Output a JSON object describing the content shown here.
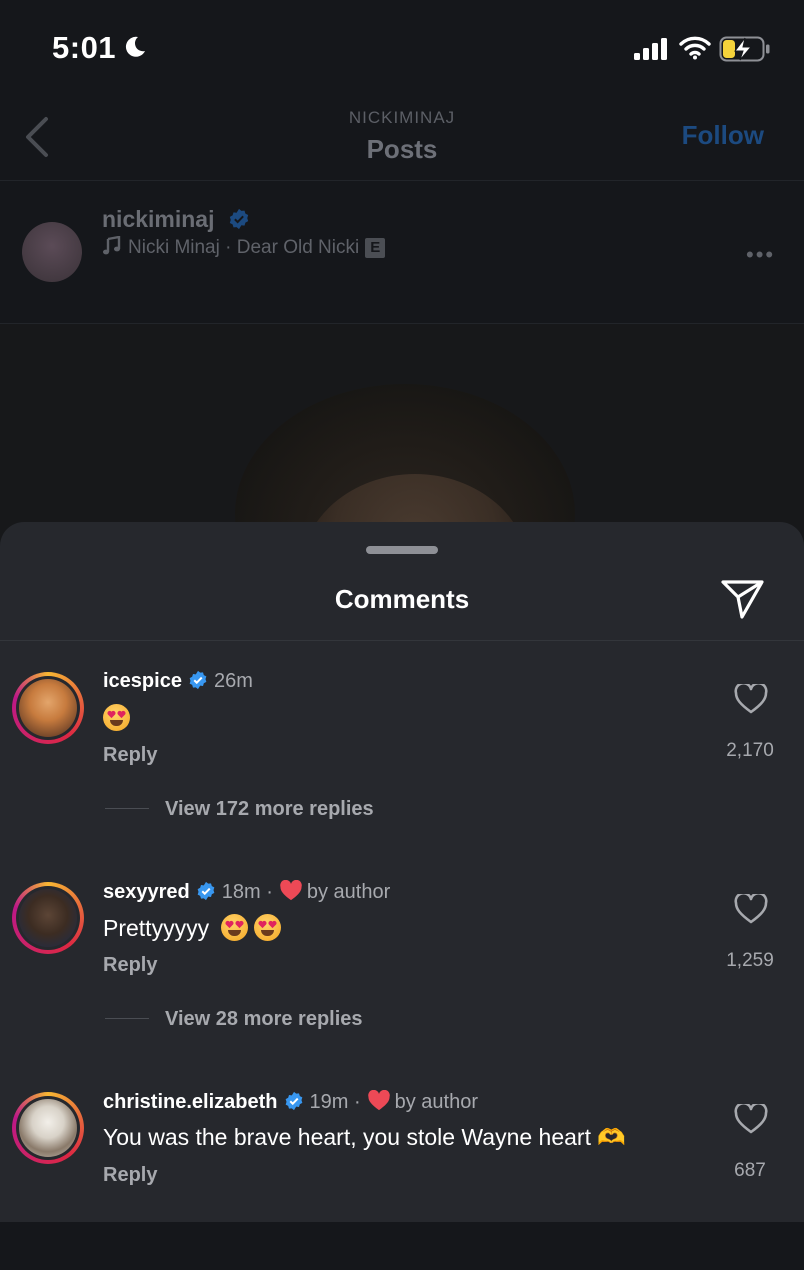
{
  "status_bar": {
    "time": "5:01"
  },
  "header": {
    "username": "NICKIMINAJ",
    "title": "Posts",
    "follow_label": "Follow"
  },
  "post": {
    "username": "nickiminaj",
    "music": "Nicki Minaj · Dear Old Nicki",
    "explicit_badge": "E"
  },
  "comments_sheet": {
    "title": "Comments",
    "comments": [
      {
        "username": "icespice",
        "age": "26m",
        "liked_by_author": false,
        "by_author_label": "",
        "text": "",
        "emojis": 1,
        "reply_label": "Reply",
        "likes": "2,170",
        "view_replies": "View 172 more replies"
      },
      {
        "username": "sexyyred",
        "age": "18m",
        "liked_by_author": true,
        "by_author_label": "by author",
        "text": "Prettyyyyy",
        "emojis": 2,
        "reply_label": "Reply",
        "likes": "1,259",
        "view_replies": "View 28 more replies"
      },
      {
        "username": "christine.elizabeth",
        "age": "19m",
        "liked_by_author": true,
        "by_author_label": "by author",
        "text": "You was the brave heart, you stole Wayne heart 🫶",
        "emojis": 0,
        "reply_label": "Reply",
        "likes": "687",
        "view_replies": ""
      }
    ]
  },
  "colors": {
    "verified_blue": "#3897f0",
    "author_heart": "#ed4956",
    "sheet_bg": "#26282d"
  },
  "icons": [
    "moon-icon",
    "signal-icon",
    "wifi-icon",
    "battery-charging-icon",
    "back-chevron-icon",
    "music-note-icon",
    "verified-icon",
    "more-icon",
    "share-icon",
    "heart-icon"
  ]
}
